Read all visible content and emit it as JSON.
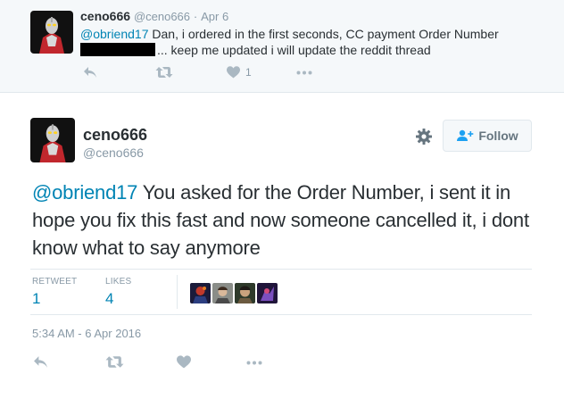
{
  "parent_tweet": {
    "display_name": "ceno666",
    "handle": "@ceno666",
    "separator": "·",
    "date": "Apr 6",
    "mention": "@obriend17",
    "text_line1": " Dan, i ordered in the first seconds, CC payment Order Number",
    "text_line2": "... keep me updated i will update the reddit thread",
    "like_count": "1",
    "actions": [
      "reply-icon",
      "retweet-icon",
      "heart-icon",
      "more-icon"
    ]
  },
  "main_tweet": {
    "display_name": "ceno666",
    "handle": "@ceno666",
    "follow_label": "Follow",
    "mention": "@obriend17",
    "text": " You asked for the Order Number, i sent it in hope you fix this fast and now someone cancelled it, i dont know what to say anymore",
    "retweet_label": "RETWEET",
    "retweet_count": "1",
    "likes_label": "LIKES",
    "likes_count": "4",
    "timestamp": "5:34 AM - 6 Apr 2016",
    "actions": [
      "reply-icon",
      "retweet-icon",
      "heart-icon",
      "more-icon"
    ]
  },
  "colors": {
    "link": "#0084b4",
    "muted": "#8899a6",
    "icon": "#aab8c2",
    "parent_bg": "#f5f8fa"
  }
}
